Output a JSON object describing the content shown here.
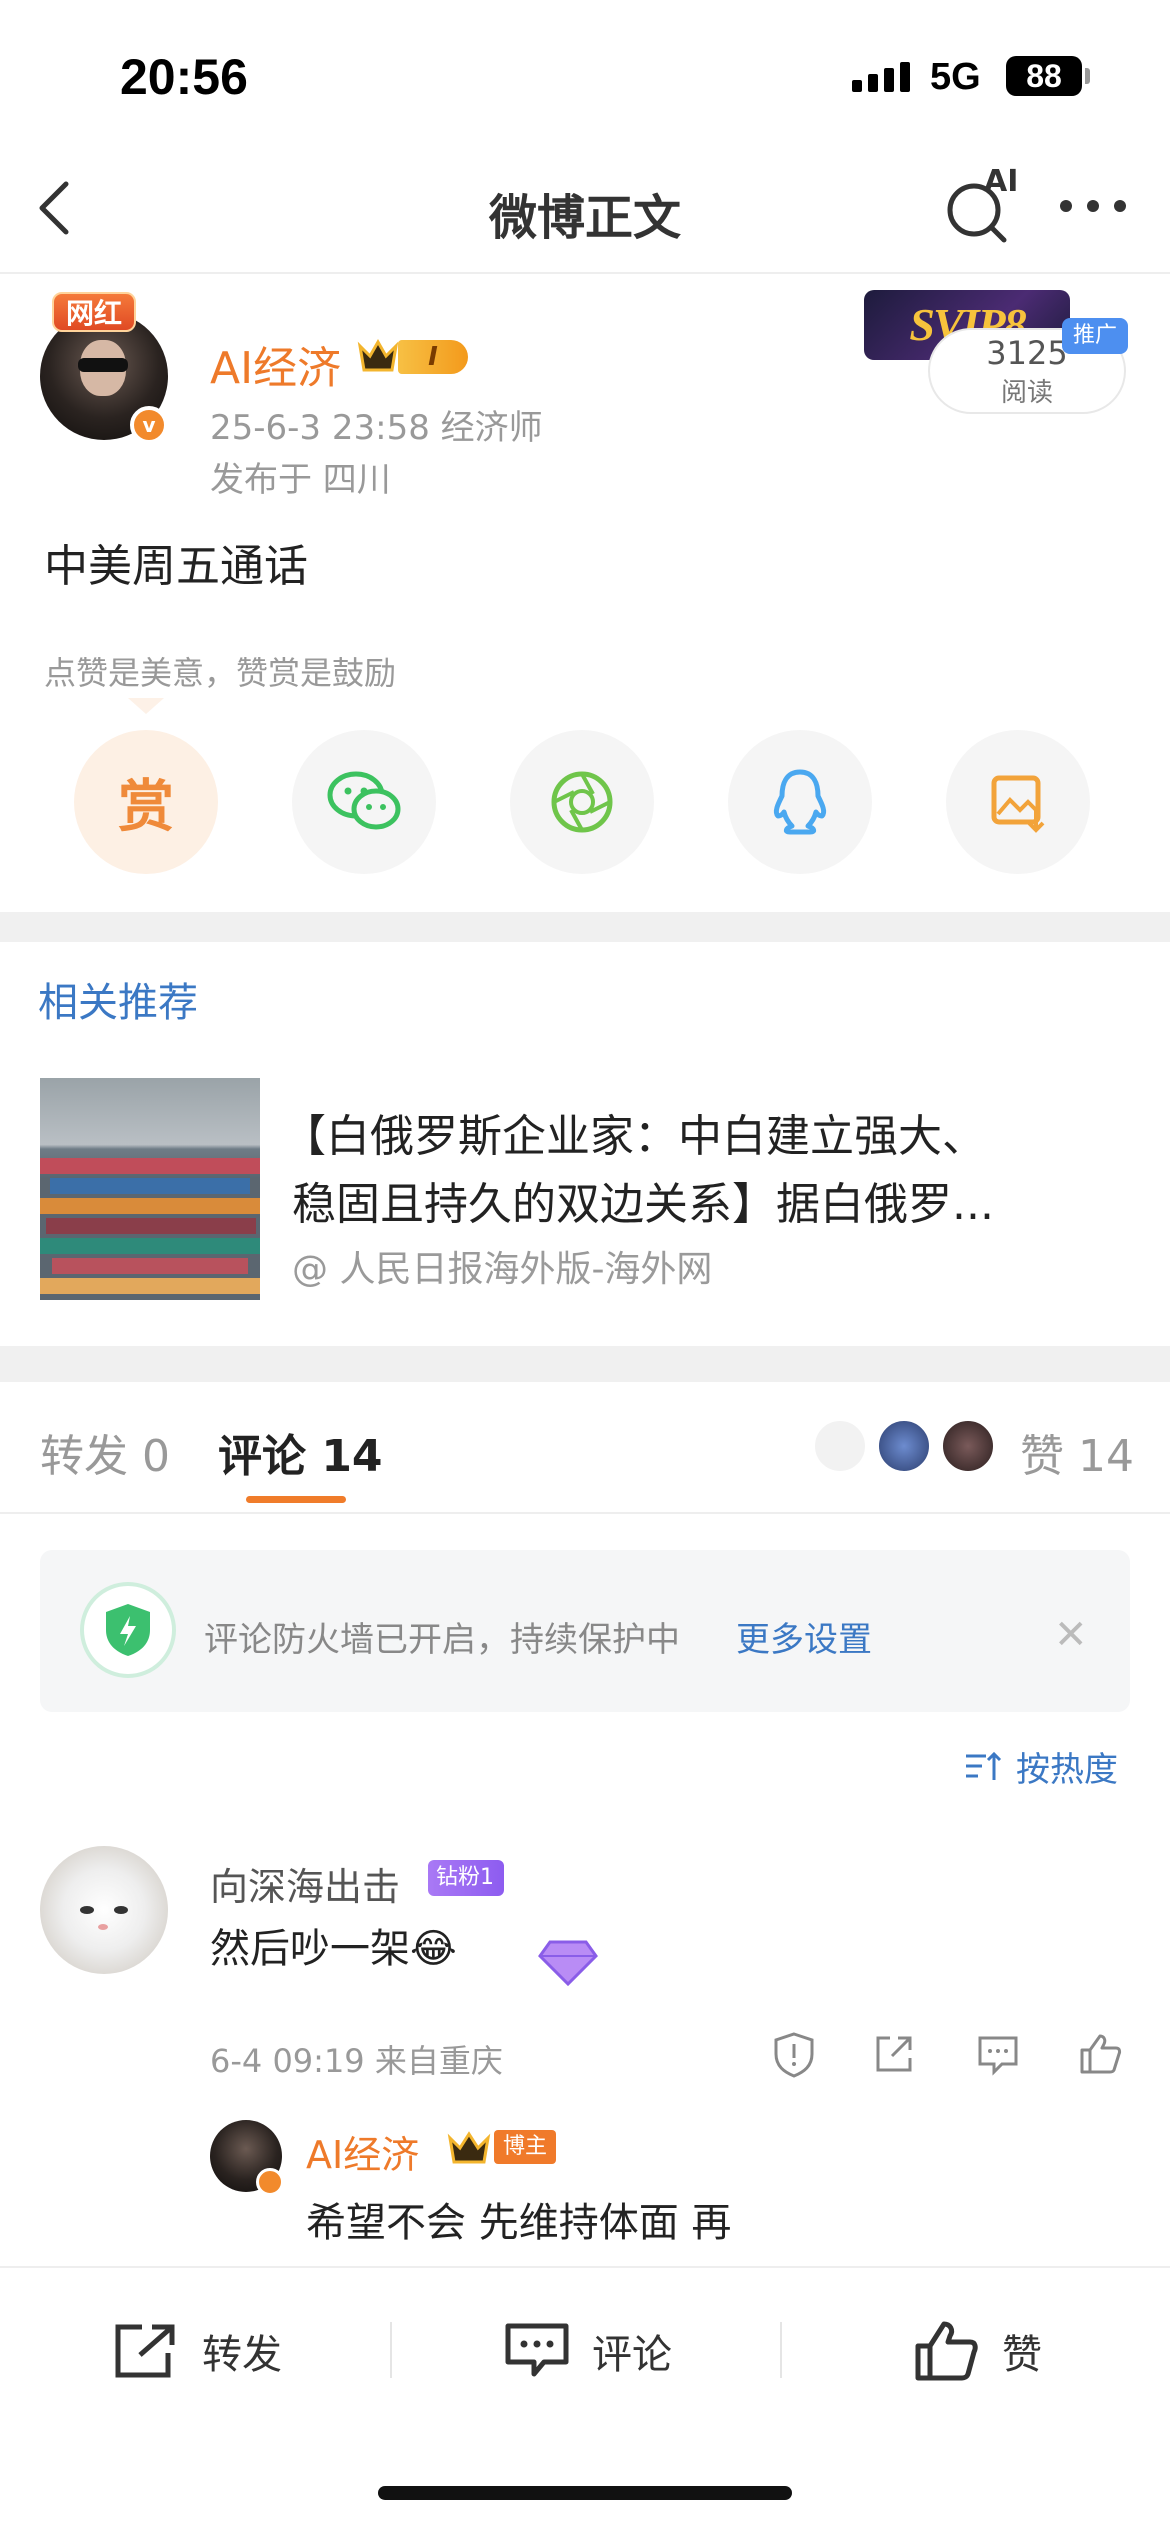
{
  "status_bar": {
    "time": "20:56",
    "network": "5G",
    "battery": "88"
  },
  "nav": {
    "title": "微博正文",
    "ai_label": "AI"
  },
  "post": {
    "badge": "网红",
    "author": "AI经济",
    "level": "I",
    "vip_badge": "SVIP8",
    "read_count": "3125",
    "read_label": "阅读",
    "promo_label": "推广",
    "time_and_title": "25-6-3 23:58  经济师",
    "location": "发布于 四川",
    "text": "中美周五通话",
    "reward_tip": "点赞是美意，赞赏是鼓励",
    "reward_button": "赏"
  },
  "related": {
    "title": "相关推荐",
    "line1": "【白俄罗斯企业家：中白建立强大、",
    "line2": "稳固且持久的双边关系】据白俄罗...",
    "source": "@ 人民日报海外版-海外网"
  },
  "tabs": {
    "repost": "转发 0",
    "comment": "评论 14",
    "likes": "赞 14"
  },
  "firewall": {
    "text": "评论防火墙已开启，持续保护中",
    "more": "更多设置",
    "close": "✕"
  },
  "sort": {
    "label": "按热度"
  },
  "comment": {
    "name": "向深海出击",
    "badge": "钻粉1",
    "text": "然后吵一架",
    "emoji": "😂",
    "time": "6-4 09:19  来自重庆"
  },
  "reply": {
    "name": "AI经济",
    "badge": "博主",
    "text": "希望不会 先维持体面 再"
  },
  "bottom_bar": {
    "repost": "转发",
    "comment": "评论",
    "like": "赞"
  },
  "colors": {
    "accent_orange": "#ee7a2a",
    "link_blue": "#3b78c4",
    "wechat_green": "#3cc25f",
    "qq_blue": "#4aa8f0"
  }
}
